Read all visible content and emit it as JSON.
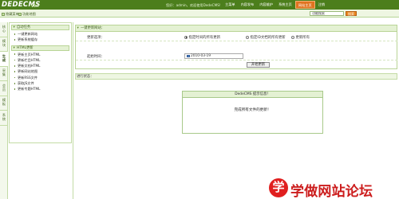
{
  "header": {
    "logo": "DEDECMS",
    "version": "V5.7",
    "welcome": "您好：admin，欢迎使用DedeCMS!",
    "nav": [
      {
        "label": "主菜单",
        "active": false
      },
      {
        "label": "内容发布",
        "active": false
      },
      {
        "label": "内容维护",
        "active": false
      },
      {
        "label": "系统主页",
        "active": false
      },
      {
        "label": "网站主页",
        "active": true
      },
      {
        "label": "注销",
        "active": false
      }
    ]
  },
  "subbar": {
    "hide_menu": "隐藏菜单",
    "feature_map": "功能地图",
    "search_value": "功能搜索",
    "search_button": "搜索"
  },
  "vtabs": [
    "核心",
    "模块",
    "生成",
    "采集",
    "会员",
    "模板",
    "系统"
  ],
  "vtab_active_index": 2,
  "left_menu": {
    "groups": [
      {
        "title": "自动任务",
        "items": [
          "一键更新网站",
          "更新系统缓存"
        ]
      },
      {
        "title": "HTML更新",
        "items": [
          "更新主页HTML",
          "更新栏目HTML",
          "更新文档HTML",
          "更新网站地图",
          "更新RSS文件",
          "获取JS文件",
          "更新专题HTML"
        ]
      }
    ]
  },
  "form": {
    "title": "一键更新网站：",
    "update_label": "更新选项：",
    "options": [
      {
        "label": "指定时间的所有更新",
        "checked": true
      },
      {
        "label": "指定ID文档的所有更新",
        "checked": false
      },
      {
        "label": "更新所有",
        "checked": false
      }
    ],
    "start_label": "起始时间：",
    "start_value": "2010-03-19",
    "start_button": "开始更新"
  },
  "status": {
    "label": "进行状态："
  },
  "message": {
    "title": "DedeCMS 提示信息！",
    "body": "完成所有文件的更新！"
  },
  "watermark": {
    "icon_char": "学",
    "text": "学做网站论坛"
  },
  "colors": {
    "header_green": "#4c7e1c",
    "active_orange": "#e0731f",
    "panel_green": "#e4f1d3",
    "watermark_red": "#e01f1f"
  }
}
